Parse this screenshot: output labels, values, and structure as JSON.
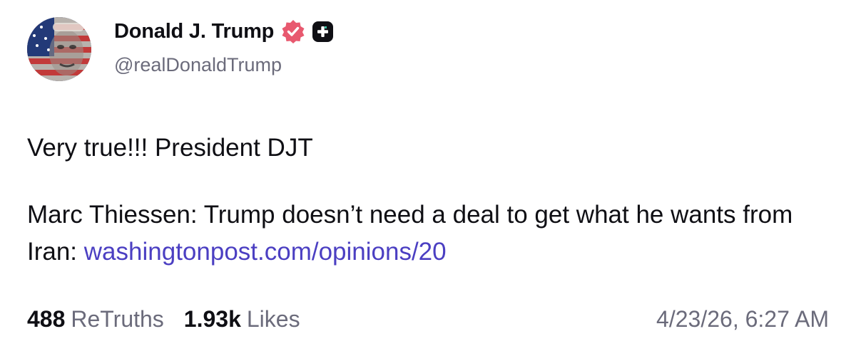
{
  "author": {
    "display_name": "Donald J. Trump",
    "handle": "@realDonaldTrump",
    "verified_icon": "verified-badge-icon",
    "verified_color": "#e8596f",
    "plus_icon": "plus-square-icon"
  },
  "post": {
    "line1": "Very true!!! President DJT",
    "line2_text": "Marc Thiessen: Trump doesn’t need a deal to get what he wants from Iran:",
    "link_text": "washingtonpost.com/opinions/20",
    "link_color": "#4b3fc2"
  },
  "stats": {
    "retruths_count": "488",
    "retruths_label": "ReTruths",
    "likes_count": "1.93k",
    "likes_label": "Likes"
  },
  "timestamp": "4/23/26, 6:27 AM"
}
